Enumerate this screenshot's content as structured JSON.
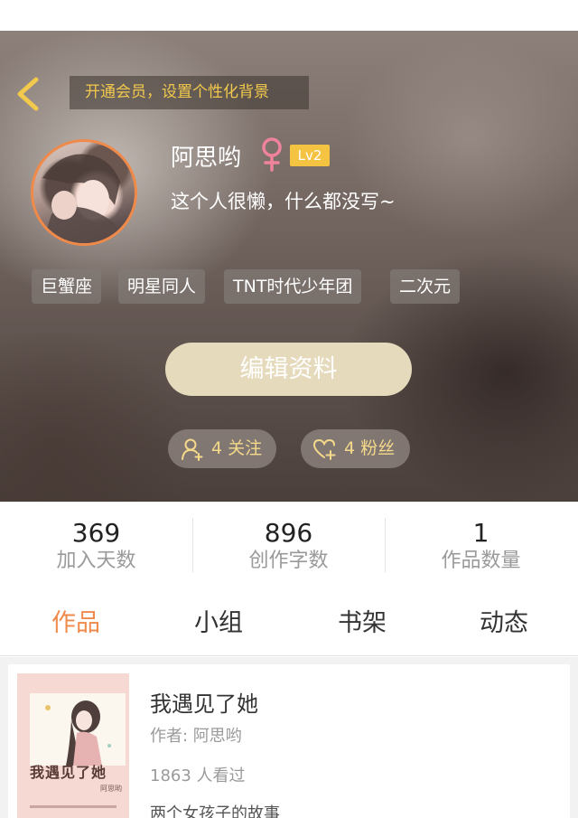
{
  "header": {
    "vip_banner": "开通会员，设置个性化背景",
    "back_icon": "chevron-left-icon",
    "accent_color": "#f2c94c"
  },
  "profile": {
    "username": "阿思哟",
    "gender_icon": "female-icon",
    "level": "Lv2",
    "bio": "这个人很懒，什么都没写~",
    "tags": [
      "巨蟹座",
      "明星同人",
      "TNT时代少年团",
      "二次元"
    ],
    "edit_button": "编辑资料",
    "following": "4 关注",
    "followers": "4 粉丝"
  },
  "stats": [
    {
      "value": "369",
      "label": "加入天数"
    },
    {
      "value": "896",
      "label": "创作字数"
    },
    {
      "value": "1",
      "label": "作品数量"
    }
  ],
  "tabs": [
    {
      "label": "作品",
      "active": true
    },
    {
      "label": "小组",
      "active": false
    },
    {
      "label": "书架",
      "active": false
    },
    {
      "label": "动态",
      "active": false
    }
  ],
  "works": [
    {
      "title": "我遇见了她",
      "author": "作者: 阿思哟",
      "views": "1863 人看过",
      "description": "两个女孩子的故事",
      "cover_title": "我遇见了她",
      "cover_author": "阿思哟"
    }
  ],
  "colors": {
    "active_tab": "#f08a4b",
    "level_badge": "#f5c342",
    "edit_button": "#e6dabc"
  }
}
